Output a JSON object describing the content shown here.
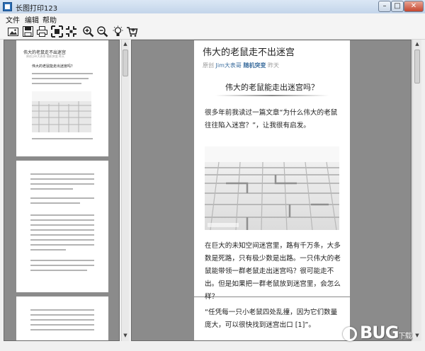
{
  "window": {
    "title": "长图打印123",
    "minimize_glyph": "–",
    "maximize_glyph": "□",
    "close_glyph": "✕"
  },
  "menu": {
    "items": [
      "文件",
      "编辑",
      "帮助"
    ]
  },
  "toolbar": {
    "icons": [
      "open-image-icon",
      "save-icon",
      "print-icon",
      "fit-page-icon",
      "actual-size-icon",
      "zoom-in-icon",
      "zoom-out-icon",
      "bulb-icon",
      "cart-icon"
    ]
  },
  "thumbnail": {
    "title": "伟大的老鼠走不出迷宫",
    "meta": "原创   Jim大表哥   随机突变   昨天",
    "heading": "伟大的老鼠能走出迷宫吗？"
  },
  "article": {
    "title": "伟大的老鼠走不出迷宫",
    "meta_original": "原创",
    "meta_author": "Jim大表哥",
    "meta_highlight": "随机突变",
    "meta_date": "昨天",
    "heading": "伟大的老鼠能走出迷宫吗？",
    "paragraph1": "很多年前我读过一篇文章“为什么伟大的老鼠往往陷入迷宫？”，让我很有启发。",
    "paragraph2": "在巨大的未知空间迷宫里，路有千万条，大多数是死路，只有极少数是出路。一只伟大的老鼠能带领一群老鼠走出迷宫吗？很可能走不出。但是如果把一群老鼠放到迷宫里，会怎么样？",
    "paragraph3": "“任凭每一只小老鼠四处乱撞，因为它们数量庞大，可以很快找到迷宫出口 [1]”。"
  },
  "watermark": {
    "text": "BUG",
    "suffix": "下载"
  },
  "colors": {
    "titlebar_top": "#dbe7f5",
    "panel_bg": "#8b8b8b",
    "link": "#3c6e9e",
    "close_button": "#c5462f"
  }
}
